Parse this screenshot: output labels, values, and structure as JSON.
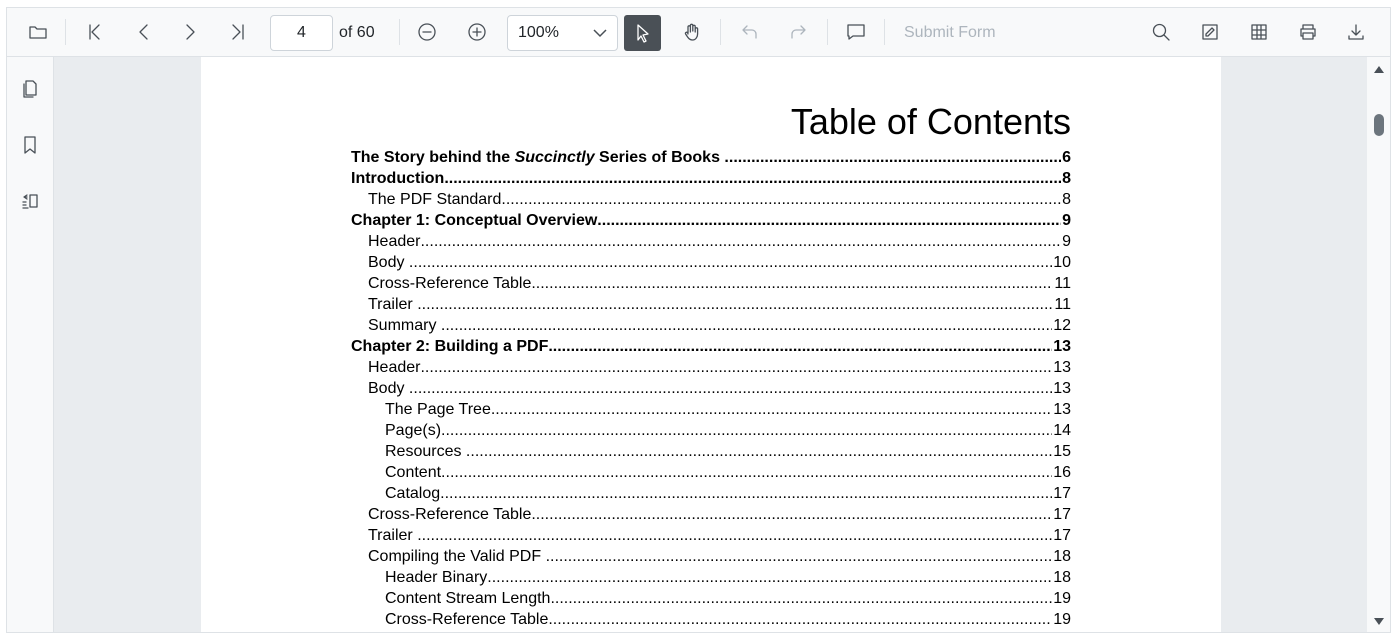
{
  "toolbar": {
    "icons": [
      "folder-open-icon",
      "first-page-icon",
      "previous-page-icon",
      "next-page-icon",
      "last-page-icon",
      "zoom-out-icon",
      "zoom-in-icon",
      "selection-tool-icon",
      "pan-tool-icon",
      "undo-icon",
      "redo-icon",
      "comment-icon",
      "search-icon",
      "annotation-icon",
      "form-designer-icon",
      "print-icon",
      "download-icon"
    ],
    "current_page": "4",
    "of_label": "of 60",
    "zoom": "100%",
    "submit_form": "Submit Form"
  },
  "sidebar": {
    "icons": [
      "page-thumbnails-icon",
      "bookmarks-icon",
      "organize-pages-icon"
    ]
  },
  "document": {
    "title": "Table of Contents",
    "entries": [
      {
        "pre": "The Story behind the ",
        "em": "Succinctly",
        "post": " Series of Books ",
        "page": "6",
        "level": 0,
        "bold": true
      },
      {
        "text": "Introduction",
        "page": "8",
        "level": 0,
        "bold": true
      },
      {
        "text": "The PDF Standard",
        "page": "8",
        "level": 1,
        "bold": false
      },
      {
        "text": "Chapter 1: Conceptual Overview",
        "page": "9",
        "level": 0,
        "bold": true
      },
      {
        "text": "Header",
        "page": "9",
        "level": 1,
        "bold": false
      },
      {
        "text": "Body ",
        "page": "10",
        "level": 1,
        "bold": false
      },
      {
        "text": "Cross-Reference Table",
        "page": "11",
        "level": 1,
        "bold": false
      },
      {
        "text": "Trailer ",
        "page": "11",
        "level": 1,
        "bold": false
      },
      {
        "text": "Summary ",
        "page": "12",
        "level": 1,
        "bold": false
      },
      {
        "text": "Chapter 2: Building a PDF",
        "page": "13",
        "level": 0,
        "bold": true
      },
      {
        "text": "Header",
        "page": "13",
        "level": 1,
        "bold": false
      },
      {
        "text": "Body ",
        "page": "13",
        "level": 1,
        "bold": false
      },
      {
        "text": "The Page Tree",
        "page": "13",
        "level": 2,
        "bold": false
      },
      {
        "text": "Page(s)",
        "page": "14",
        "level": 2,
        "bold": false
      },
      {
        "text": "Resources ",
        "page": "15",
        "level": 2,
        "bold": false
      },
      {
        "text": "Content",
        "page": "16",
        "level": 2,
        "bold": false
      },
      {
        "text": "Catalog",
        "page": "17",
        "level": 2,
        "bold": false
      },
      {
        "text": "Cross-Reference Table",
        "page": "17",
        "level": 1,
        "bold": false
      },
      {
        "text": "Trailer ",
        "page": "17",
        "level": 1,
        "bold": false
      },
      {
        "text": "Compiling the Valid PDF ",
        "page": "18",
        "level": 1,
        "bold": false
      },
      {
        "text": "Header Binary",
        "page": "18",
        "level": 2,
        "bold": false
      },
      {
        "text": "Content Stream Length",
        "page": "19",
        "level": 2,
        "bold": false
      },
      {
        "text": "Cross-Reference Table",
        "page": "19",
        "level": 2,
        "bold": false
      }
    ]
  }
}
